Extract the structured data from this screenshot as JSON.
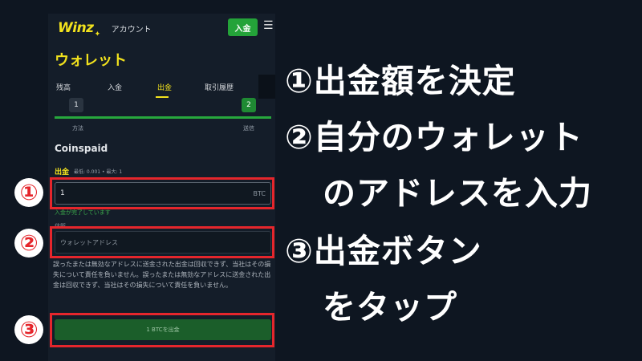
{
  "header": {
    "logo": "Winz",
    "logo_star": "✦",
    "account_link": "アカウント",
    "deposit_button": "入金",
    "menu_icon": "hamburger-menu-icon"
  },
  "wallet": {
    "title": "ウォレット",
    "tabs": [
      "残高",
      "入金",
      "出金",
      "取引履歴"
    ],
    "active_tab": "出金",
    "steps": [
      "1",
      "2"
    ],
    "step_labels": [
      "方法",
      "送信"
    ],
    "progress": 1.0,
    "provider": "Coinspaid",
    "amount_label": "出金",
    "amount_limits": "最低: 0.001 • 最大: 1",
    "amount_value": "1",
    "amount_unit": "BTC",
    "amount_hint": "入金が完了しています",
    "address_label": "住所",
    "address_placeholder": "ウォレットアドレス",
    "warning": "誤ったまたは無効なアドレスに送金された出金は回収できず、当社はその損失について責任を負いません。誤ったまたは無効なアドレスに送金された出金は回収できず、当社はその損失について責任を負いません。",
    "withdraw_button": "1 BTCを出金"
  },
  "annotations": {
    "markers": [
      "①",
      "②",
      "③"
    ],
    "highlight_color": "#e5262c",
    "lines": [
      "①出金額を決定",
      "②自分のウォレット",
      "のアドレスを入力",
      "③出金ボタン",
      "をタップ"
    ]
  },
  "colors": {
    "accent": "#f2e21d",
    "primary_button": "#24a339",
    "background": "#0e1621"
  }
}
